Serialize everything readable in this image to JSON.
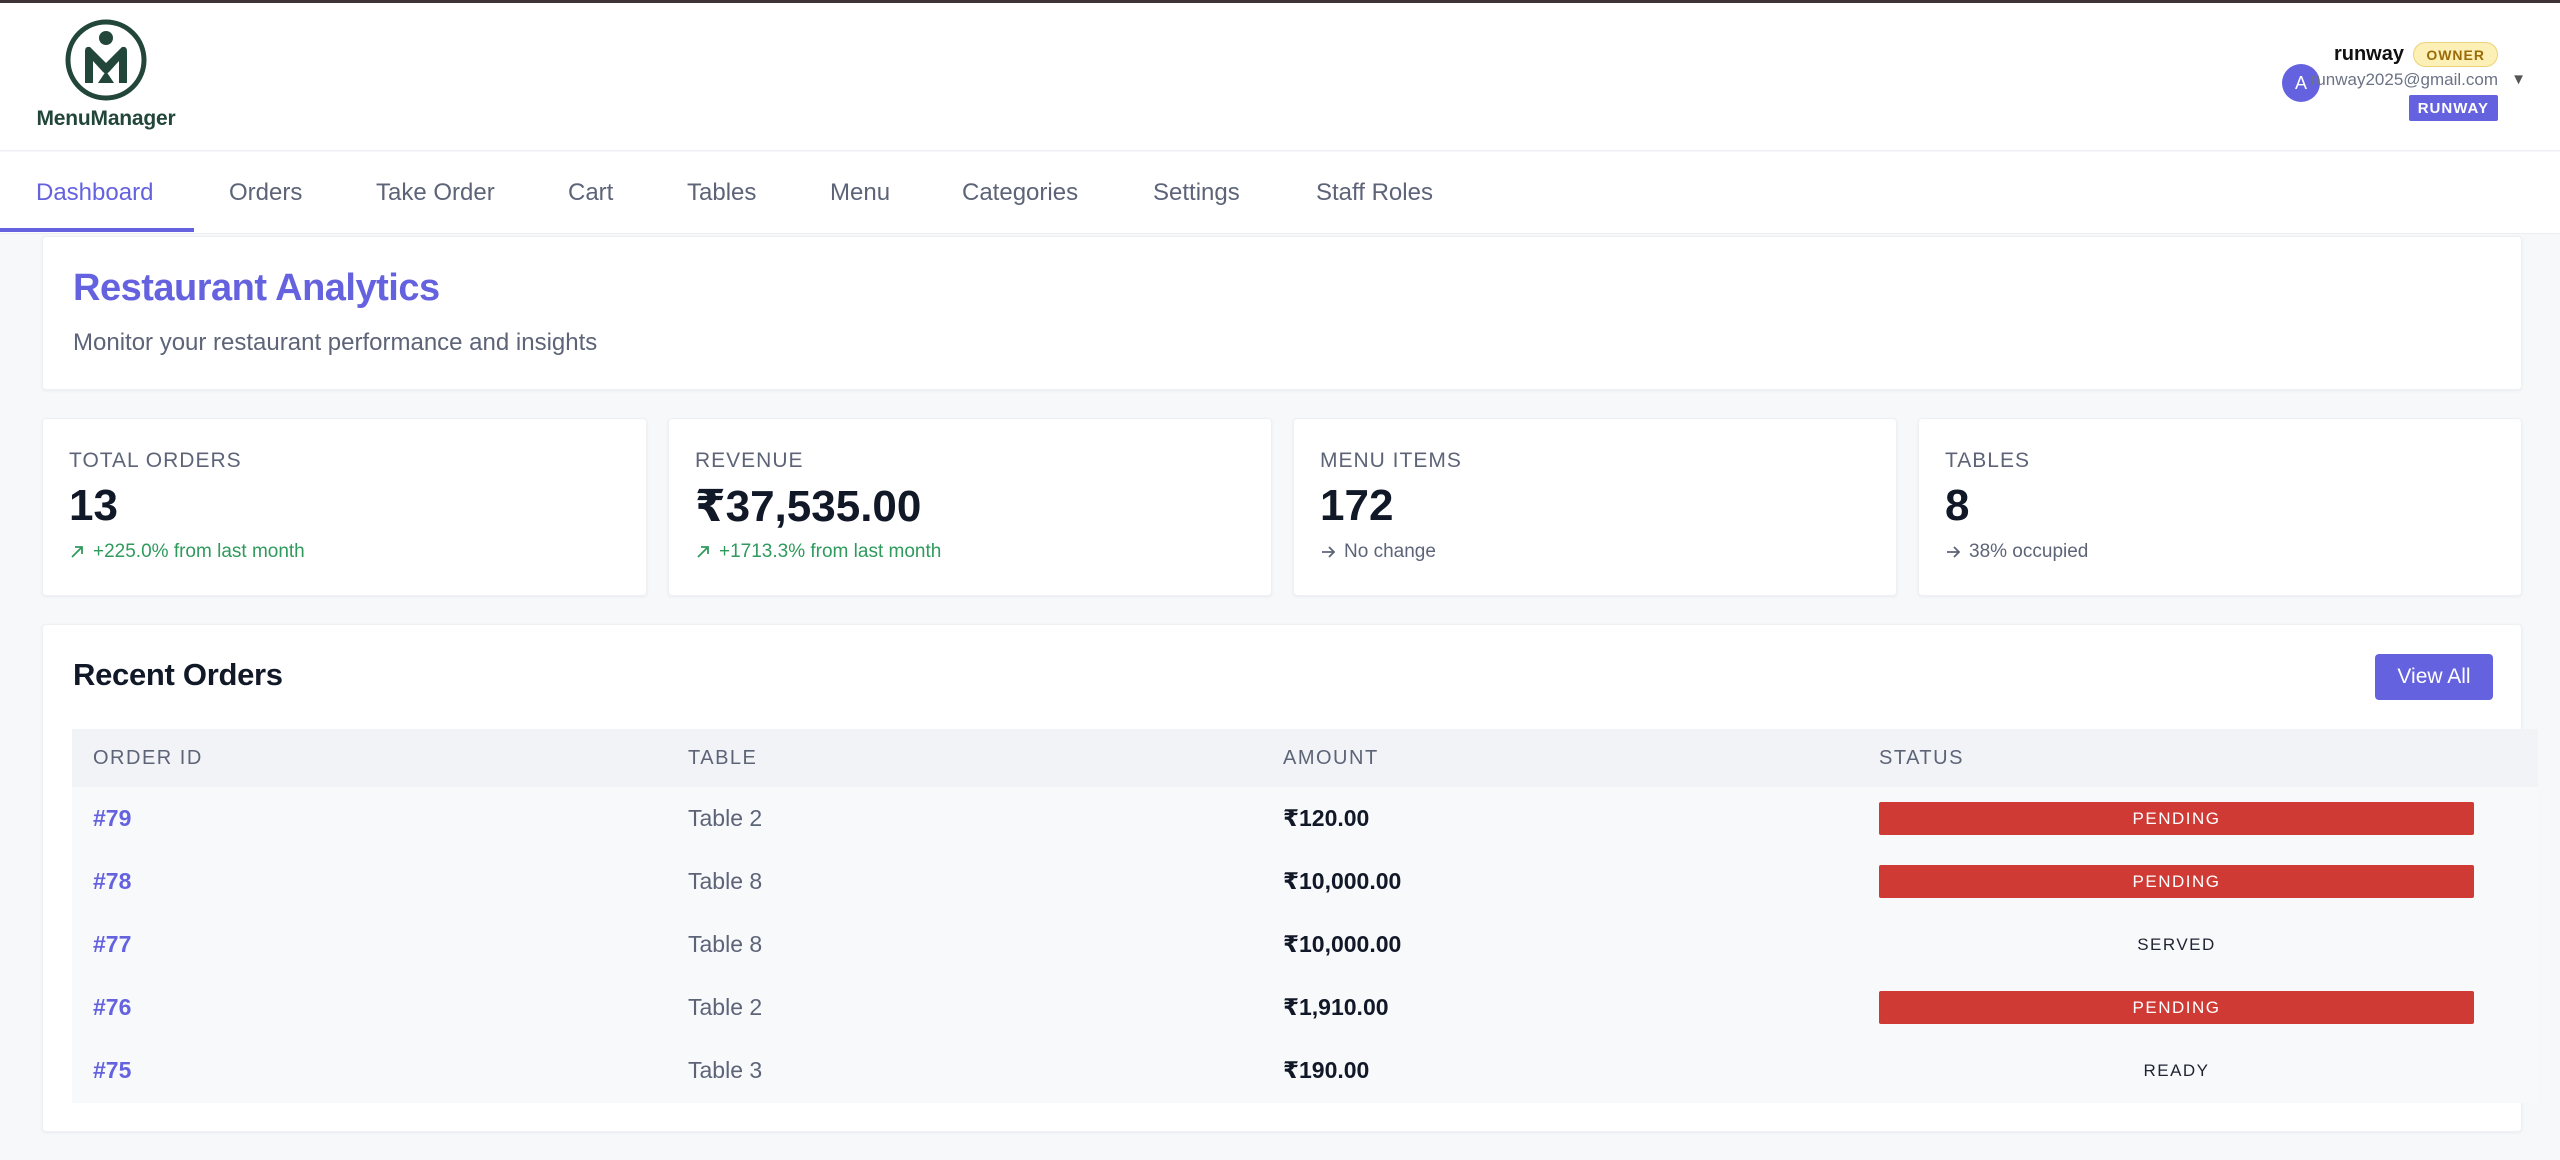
{
  "brand": {
    "name": "MenuManager"
  },
  "user": {
    "avatar_initial": "A",
    "name": "runway",
    "role_badge": "OWNER",
    "email": "runway2025@gmail.com",
    "org_badge": "RUNWAY"
  },
  "nav": {
    "tabs": [
      {
        "label": "Dashboard",
        "active": true
      },
      {
        "label": "Orders"
      },
      {
        "label": "Take Order"
      },
      {
        "label": "Cart"
      },
      {
        "label": "Tables"
      },
      {
        "label": "Menu"
      },
      {
        "label": "Categories"
      },
      {
        "label": "Settings"
      },
      {
        "label": "Staff Roles"
      }
    ]
  },
  "hero": {
    "title": "Restaurant Analytics",
    "subtitle": "Monitor your restaurant performance and insights"
  },
  "stats": [
    {
      "label": "TOTAL ORDERS",
      "value": "13",
      "change": "+225.0% from last month",
      "trend": "up"
    },
    {
      "label": "REVENUE",
      "value": "₹37,535.00",
      "change": "+1713.3% from last month",
      "trend": "up"
    },
    {
      "label": "MENU ITEMS",
      "value": "172",
      "change": "No change",
      "trend": "flat"
    },
    {
      "label": "TABLES",
      "value": "8",
      "change": "38% occupied",
      "trend": "flat"
    }
  ],
  "recent_orders": {
    "title": "Recent Orders",
    "view_all_label": "View All",
    "columns": [
      "ORDER ID",
      "TABLE",
      "AMOUNT",
      "STATUS"
    ],
    "rows": [
      {
        "id": "#79",
        "table": "Table 2",
        "amount": "₹120.00",
        "status": "PENDING"
      },
      {
        "id": "#78",
        "table": "Table 8",
        "amount": "₹10,000.00",
        "status": "PENDING"
      },
      {
        "id": "#77",
        "table": "Table 8",
        "amount": "₹10,000.00",
        "status": "SERVED"
      },
      {
        "id": "#76",
        "table": "Table 2",
        "amount": "₹1,910.00",
        "status": "PENDING"
      },
      {
        "id": "#75",
        "table": "Table 3",
        "amount": "₹190.00",
        "status": "READY"
      }
    ]
  },
  "colors": {
    "accent": "#6462df",
    "pending": "#cf3a34",
    "positive": "#2f9a5c",
    "logo": "#22463a"
  },
  "icons": {
    "logo": "menumanager-logo-icon",
    "trend_up": "arrow-up-right-icon",
    "trend_flat": "arrow-right-icon",
    "caret": "chevron-down-icon"
  }
}
